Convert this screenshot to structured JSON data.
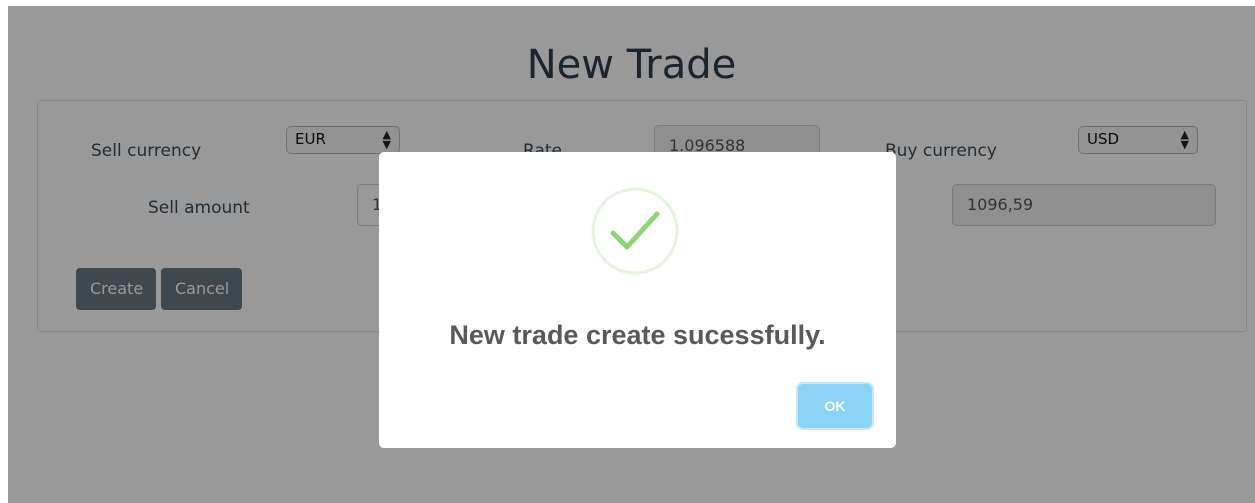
{
  "page": {
    "title": "New Trade"
  },
  "form": {
    "sell_currency_label": "Sell currency",
    "sell_currency_value": "EUR",
    "rate_label": "Rate",
    "rate_value": "1.096588",
    "buy_currency_label": "Buy currency",
    "buy_currency_value": "USD",
    "sell_amount_label": "Sell amount",
    "sell_amount_value": "1",
    "buy_amount_value": "1096,59",
    "create_label": "Create",
    "cancel_label": "Cancel"
  },
  "dialog": {
    "message": "New trade create sucessfully.",
    "ok_label": "OK",
    "icon": "check-icon",
    "colors": {
      "check": "#8ed47a",
      "ok_button": "#8cd4f5"
    }
  }
}
